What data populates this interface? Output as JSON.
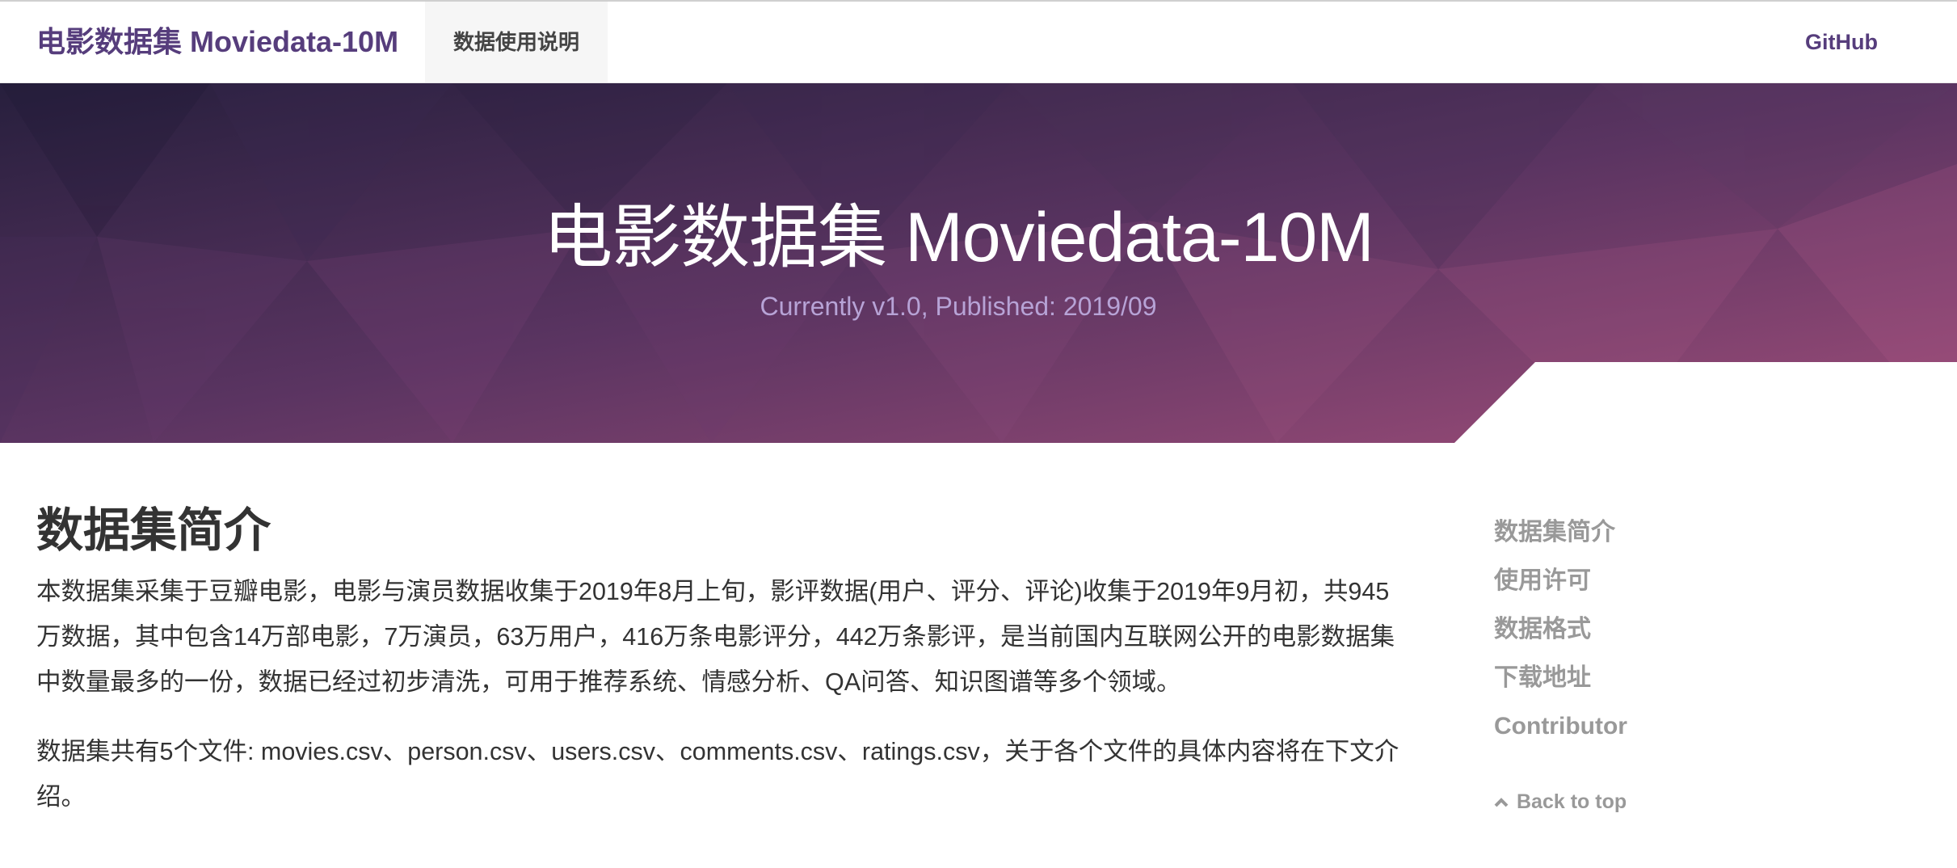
{
  "navbar": {
    "brand": "电影数据集 Moviedata-10M",
    "nav_item": "数据使用说明",
    "github": "GitHub"
  },
  "hero": {
    "title": "电影数据集 Moviedata-10M",
    "subtitle": "Currently v1.0, Published: 2019/09"
  },
  "content": {
    "heading": "数据集简介",
    "para1": "本数据集采集于豆瓣电影，电影与演员数据收集于2019年8月上旬，影评数据(用户、评分、评论)收集于2019年9月初，共945万数据，其中包含14万部电影，7万演员，63万用户，416万条电影评分，442万条影评，是当前国内互联网公开的电影数据集中数量最多的一份，数据已经过初步清洗，可用于推荐系统、情感分析、QA问答、知识图谱等多个领域。",
    "para2": "数据集共有5个文件: movies.csv、person.csv、users.csv、comments.csv、ratings.csv，关于各个文件的具体内容将在下文介绍。"
  },
  "sidebar": {
    "items": [
      {
        "label": "数据集简介"
      },
      {
        "label": "使用许可"
      },
      {
        "label": "数据格式"
      },
      {
        "label": "下载地址"
      },
      {
        "label": "Contributor"
      }
    ],
    "back_to_top": "Back to top",
    "back_to_top_icon": "chevron-up-icon"
  },
  "colors": {
    "brand": "#563d7c",
    "hero_dark": "#2c2243",
    "hero_light": "#a04d7a",
    "sidebar_text": "#999999"
  }
}
